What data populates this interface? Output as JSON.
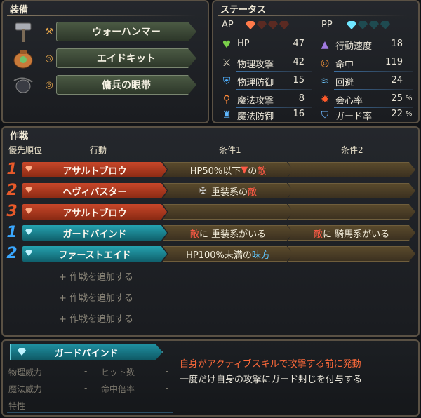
{
  "equipment": {
    "title": "装備",
    "items": [
      {
        "name": "ウォーハンマー",
        "icon": "hammer-icon",
        "small_icon": "axe-icon"
      },
      {
        "name": "エイドキット",
        "icon": "bag-icon",
        "small_icon": "ring-icon"
      },
      {
        "name": "傭兵の眼帯",
        "icon": "eyepatch-icon",
        "small_icon": "ring-icon"
      }
    ]
  },
  "status": {
    "title": "ステータス",
    "ap_label": "AP",
    "pp_label": "PP",
    "left": [
      {
        "label": "HP",
        "value": "47",
        "icon": "heart-icon",
        "color": "#7ad04a"
      },
      {
        "label": "物理攻撃",
        "value": "42",
        "icon": "sword-icon",
        "color": "#e0d8c0"
      },
      {
        "label": "物理防御",
        "value": "15",
        "icon": "armor-icon",
        "color": "#4fb0ff"
      },
      {
        "label": "魔法攻撃",
        "value": "8",
        "icon": "staff-icon",
        "color": "#ff8a3a"
      },
      {
        "label": "魔法防御",
        "value": "16",
        "icon": "robe-icon",
        "color": "#5fb8ff"
      }
    ],
    "right": [
      {
        "label": "行動速度",
        "value": "18",
        "icon": "hat-icon",
        "color": "#a07ae0"
      },
      {
        "label": "命中",
        "value": "119",
        "icon": "target-icon",
        "color": "#ff9a3a"
      },
      {
        "label": "回避",
        "value": "24",
        "icon": "wing-icon",
        "color": "#6fc8ff"
      },
      {
        "label": "会心率",
        "value": "25",
        "unit": "%",
        "icon": "burst-icon",
        "color": "#ff5a2a"
      },
      {
        "label": "ガード率",
        "value": "22",
        "unit": "%",
        "icon": "shield-icon",
        "color": "#6fb8ff"
      }
    ]
  },
  "tactics": {
    "title": "作戦",
    "headers": {
      "priority": "優先順位",
      "action": "行動",
      "cond1": "条件1",
      "cond2": "条件2"
    },
    "rows": [
      {
        "num": "1",
        "action": "アサルトブロウ",
        "type": "active",
        "cond1_pre": "HP50%以下",
        "cond1_mark": "▼",
        "cond1_mid": "の",
        "cond1_hl": "敵",
        "cond1_post": "",
        "cond2_pre": "",
        "cond2_hl": "",
        "cond2_post": ""
      },
      {
        "num": "2",
        "action": "ヘヴィバスター",
        "type": "active",
        "cond1_pre": "重装系の",
        "cond1_mark": "",
        "cond1_mid": "",
        "cond1_hl": "敵",
        "cond1_post": "",
        "cond2_pre": "",
        "cond2_hl": "",
        "cond2_post": ""
      },
      {
        "num": "3",
        "action": "アサルトブロウ",
        "type": "active",
        "cond1_pre": "",
        "cond1_mark": "",
        "cond1_mid": "",
        "cond1_hl": "",
        "cond1_post": "",
        "cond2_pre": "",
        "cond2_hl": "",
        "cond2_post": ""
      },
      {
        "num": "1",
        "action": "ガードバインド",
        "type": "passive",
        "cond1_pre": "",
        "cond1_mark": "",
        "cond1_mid": "",
        "cond1_hl": "敵",
        "cond1_post": "に 重装系がいる",
        "cond2_pre": "",
        "cond2_hl": "敵",
        "cond2_post": "に 騎馬系がいる"
      },
      {
        "num": "2",
        "action": "ファーストエイド",
        "type": "passive",
        "cond1_pre": "HP100%未満の",
        "cond1_mark": "",
        "cond1_mid": "",
        "cond1_hl": "味方",
        "cond1_post": "",
        "cond2_pre": "",
        "cond2_hl": "",
        "cond2_post": ""
      }
    ],
    "add_label": "+ 作戦を追加する",
    "add_count": 3,
    "colors": {
      "active": "#b53a1e",
      "passive": "#1f8a9a",
      "num_active": "#e85a2a",
      "num_passive": "#3aa8ff"
    }
  },
  "skill_detail": {
    "name": "ガードバインド",
    "stats": [
      {
        "label": "物理威力",
        "value": "-"
      },
      {
        "label": "ヒット数",
        "value": "-"
      },
      {
        "label": "魔法威力",
        "value": "-"
      },
      {
        "label": "命中倍率",
        "value": "-"
      },
      {
        "label": "特性",
        "value": ""
      }
    ],
    "trigger": "自身がアクティブスキルで攻撃する前に発動",
    "effect": "一度だけ自身の攻撃にガード封じを付与する"
  }
}
